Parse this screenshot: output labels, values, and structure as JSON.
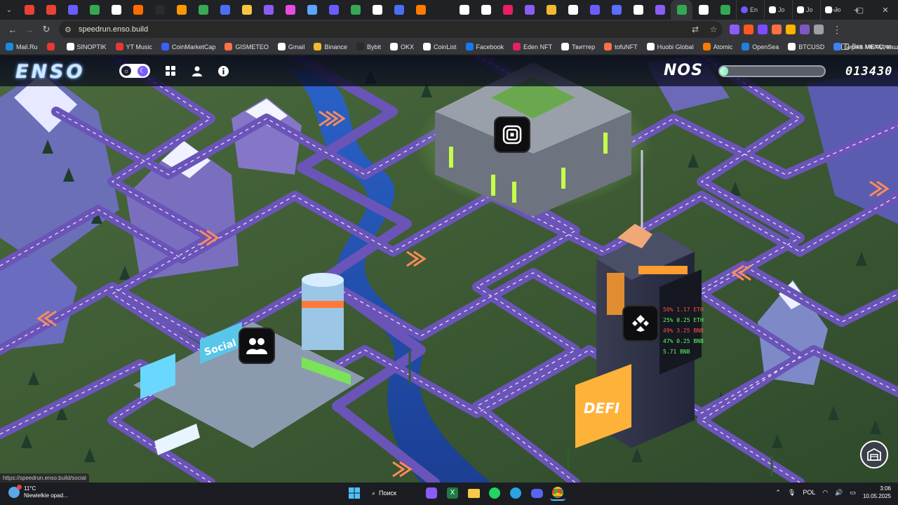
{
  "browser": {
    "tab_labels": [
      "En",
      "Jo",
      "Jo",
      "Jo"
    ],
    "tab_favicon_colors": [
      "#e94235",
      "#e94235",
      "#6a5cff",
      "#34a853",
      "#ffffff",
      "#ff6b00",
      "#2b2b2b",
      "#ff9800",
      "#3aa757",
      "#4c6ef5",
      "#f5c542",
      "#8b5cf6",
      "#e94ae0",
      "#5ea5ff",
      "#6a5cff",
      "#34a853",
      "#ffffff",
      "#4c6ef5",
      "#ff7a00",
      "#202124",
      "#ffffff",
      "#ffffff",
      "#e91e63",
      "#8b5cf6",
      "#f3ba2f",
      "#ffffff",
      "#6a5cff",
      "#5b6cff",
      "#ffffff",
      "#8b5cf6",
      "#34a853",
      "#ffffff",
      "#34a853"
    ],
    "window_controls": {
      "minimize": "—",
      "maximize": "▢",
      "close": "✕"
    },
    "url": "speedrun.enso.build",
    "extension_colors": [
      "#8b5cf6",
      "#ff5722",
      "#7c4dff",
      "#ff7043",
      "#ffb300",
      "#7e57c2",
      "#9aa0a6"
    ]
  },
  "bookmarks": {
    "items": [
      {
        "label": "Mail.Ru",
        "color": "#168de2"
      },
      {
        "label": "",
        "color": "#e53935"
      },
      {
        "label": "SINOPTIK",
        "color": "#ffffff"
      },
      {
        "label": "YT Music",
        "color": "#e53935"
      },
      {
        "label": "CoinMarketCap",
        "color": "#3861fb"
      },
      {
        "label": "GISMETEO",
        "color": "#ff7043"
      },
      {
        "label": "Gmail",
        "color": "#ffffff"
      },
      {
        "label": "Binance",
        "color": "#f3ba2f"
      },
      {
        "label": "Bybit",
        "color": "#2b2b2b"
      },
      {
        "label": "OKX",
        "color": "#ffffff"
      },
      {
        "label": "CoinList",
        "color": "#ffffff"
      },
      {
        "label": "Facebook",
        "color": "#1877f2"
      },
      {
        "label": "Eden NFT",
        "color": "#e91e63"
      },
      {
        "label": "Твиттер",
        "color": "#ffffff"
      },
      {
        "label": "tofuNFT",
        "color": "#ff7043"
      },
      {
        "label": "Huobi Global",
        "color": "#ffffff"
      },
      {
        "label": "Atomic",
        "color": "#ff7a00"
      },
      {
        "label": "OpenSea",
        "color": "#2081e2"
      },
      {
        "label": "BTCUSD",
        "color": "#ffffff"
      },
      {
        "label": "Биржа MEXC: ваш...",
        "color": "#3b82f6"
      }
    ],
    "more": "»",
    "folder": "Все закладки"
  },
  "game": {
    "logo": "ENSO",
    "nos_label": "NOS",
    "nos_level": 0.08,
    "score": "013430",
    "tower_board": [
      "50% 1.17 ETH",
      "25% 0.25 ETH",
      "49% 3.25 BNB",
      "47% 0.25 BNB",
      "5.71 BNB"
    ],
    "sign_social": "Social",
    "sign_defi": "DEFI",
    "link_preview": "https://speedrun.enso.build/social"
  },
  "taskbar": {
    "temperature": "11°C",
    "weather": "Niewielkie opad...",
    "search": "Поиск",
    "language": "POL",
    "time": "3:06",
    "date": "10.05.2025"
  }
}
